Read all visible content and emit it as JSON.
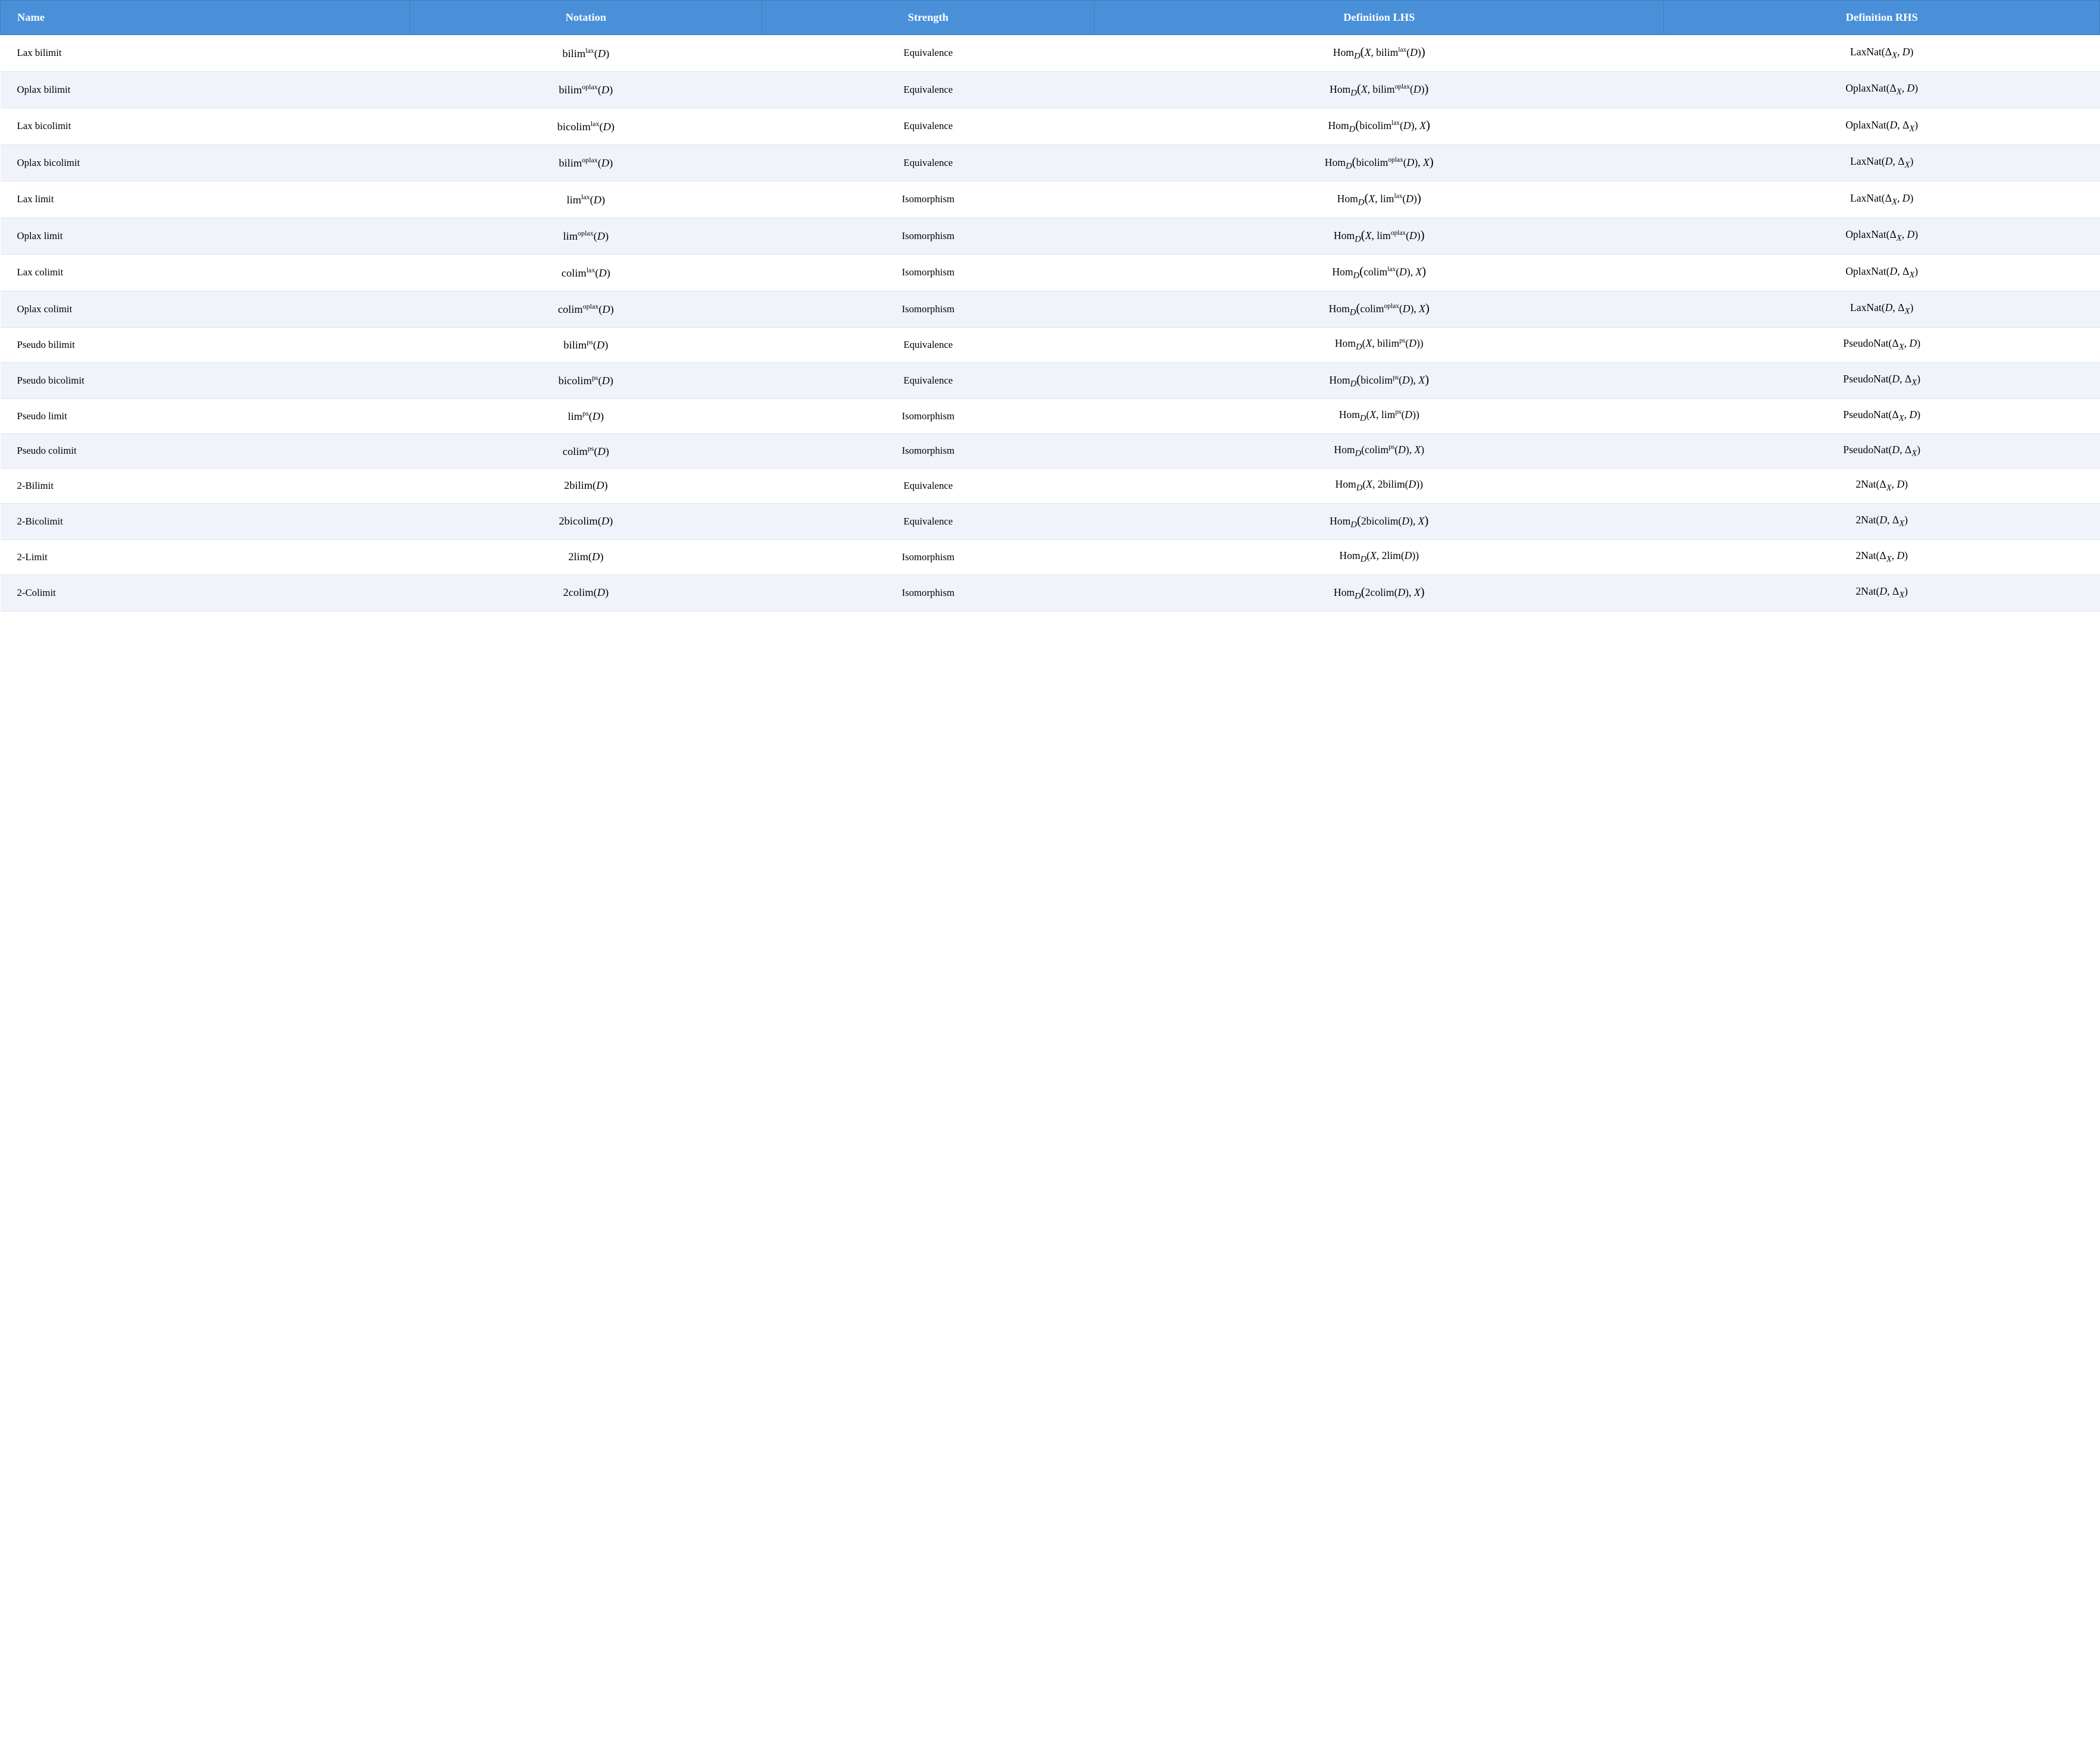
{
  "header": {
    "col1": "Name",
    "col2": "Notation",
    "col3": "Strength",
    "col4": "Definition LHS",
    "col5": "Definition RHS"
  },
  "rows": [
    {
      "name": "Lax bilimit",
      "notation_html": "bilim<sup>lax</sup>(<i>D</i>)",
      "strength": "Equivalence",
      "lhs_html": "Hom<sub><i>D</i></sub><big>(</big><i>X</i>, bilim<sup>lax</sup>(<i>D</i>)<big>)</big>",
      "rhs_html": "LaxNat(Δ<sub><i>X</i></sub>, <i>D</i>)"
    },
    {
      "name": "Oplax bilimit",
      "notation_html": "bilim<sup>oplax</sup>(<i>D</i>)",
      "strength": "Equivalence",
      "lhs_html": "Hom<sub><i>D</i></sub><big>(</big><i>X</i>, bilim<sup>oplax</sup>(<i>D</i>)<big>)</big>",
      "rhs_html": "OplaxNat(Δ<sub><i>X</i></sub>, <i>D</i>)"
    },
    {
      "name": "Lax bicolimit",
      "notation_html": "bicolim<sup>lax</sup>(<i>D</i>)",
      "strength": "Equivalence",
      "lhs_html": "Hom<sub><i>D</i></sub><big>(</big>bicolim<sup>lax</sup>(<i>D</i>), <i>X</i><big>)</big>",
      "rhs_html": "OplaxNat(<i>D</i>, Δ<sub><i>X</i></sub>)"
    },
    {
      "name": "Oplax bicolimit",
      "notation_html": "bilim<sup>oplax</sup>(<i>D</i>)",
      "strength": "Equivalence",
      "lhs_html": "Hom<sub><i>D</i></sub><big>(</big>bicolim<sup>oplax</sup>(<i>D</i>), <i>X</i><big>)</big>",
      "rhs_html": "LaxNat(<i>D</i>, Δ<sub><i>X</i></sub>)"
    },
    {
      "name": "Lax limit",
      "notation_html": "lim<sup>lax</sup>(<i>D</i>)",
      "strength": "Isomorphism",
      "lhs_html": "Hom<sub><i>D</i></sub><big>(</big><i>X</i>, lim<sup>lax</sup>(<i>D</i>)<big>)</big>",
      "rhs_html": "LaxNat(Δ<sub><i>X</i></sub>, <i>D</i>)"
    },
    {
      "name": "Oplax limit",
      "notation_html": "lim<sup>oplax</sup>(<i>D</i>)",
      "strength": "Isomorphism",
      "lhs_html": "Hom<sub><i>D</i></sub><big>(</big><i>X</i>, lim<sup>oplax</sup>(<i>D</i>)<big>)</big>",
      "rhs_html": "OplaxNat(Δ<sub><i>X</i></sub>, <i>D</i>)"
    },
    {
      "name": "Lax colimit",
      "notation_html": "colim<sup>lax</sup>(<i>D</i>)",
      "strength": "Isomorphism",
      "lhs_html": "Hom<sub><i>D</i></sub><big>(</big>colim<sup>lax</sup>(<i>D</i>), <i>X</i><big>)</big>",
      "rhs_html": "OplaxNat(<i>D</i>, Δ<sub><i>X</i></sub>)"
    },
    {
      "name": "Oplax colimit",
      "notation_html": "colim<sup>oplax</sup>(<i>D</i>)",
      "strength": "Isomorphism",
      "lhs_html": "Hom<sub><i>D</i></sub><big>(</big>colim<sup>oplax</sup>(<i>D</i>), <i>X</i><big>)</big>",
      "rhs_html": "LaxNat(<i>D</i>, Δ<sub><i>X</i></sub>)"
    },
    {
      "name": "Pseudo bilimit",
      "notation_html": "bilim<sup>ps</sup>(<i>D</i>)",
      "strength": "Equivalence",
      "lhs_html": "Hom<sub><i>D</i></sub>(<i>X</i>, bilim<sup>ps</sup>(<i>D</i>))",
      "rhs_html": "PseudoNat(Δ<sub><i>X</i></sub>, <i>D</i>)"
    },
    {
      "name": "Pseudo bicolimit",
      "notation_html": "bicolim<sup>ps</sup>(<i>D</i>)",
      "strength": "Equivalence",
      "lhs_html": "Hom<sub><i>D</i></sub><big>(</big>bicolim<sup>ps</sup>(<i>D</i>), <i>X</i><big>)</big>",
      "rhs_html": "PseudoNat(<i>D</i>, Δ<sub><i>X</i></sub>)"
    },
    {
      "name": "Pseudo limit",
      "notation_html": "lim<sup>ps</sup>(<i>D</i>)",
      "strength": "Isomorphism",
      "lhs_html": "Hom<sub><i>D</i></sub>(<i>X</i>, lim<sup>ps</sup>(<i>D</i>))",
      "rhs_html": "PseudoNat(Δ<sub><i>X</i></sub>, <i>D</i>)"
    },
    {
      "name": "Pseudo colimit",
      "notation_html": "colim<sup>ps</sup>(<i>D</i>)",
      "strength": "Isomorphism",
      "lhs_html": "Hom<sub><i>D</i></sub>(colim<sup>ps</sup>(<i>D</i>), <i>X</i>)",
      "rhs_html": "PseudoNat(<i>D</i>, Δ<sub><i>X</i></sub>)"
    },
    {
      "name": "2-Bilimit",
      "notation_html": "2bilim(<i>D</i>)",
      "strength": "Equivalence",
      "lhs_html": "Hom<sub><i>D</i></sub>(<i>X</i>, 2bilim(<i>D</i>))",
      "rhs_html": "2Nat(Δ<sub><i>X</i></sub>, <i>D</i>)"
    },
    {
      "name": "2-Bicolimit",
      "notation_html": "2bicolim(<i>D</i>)",
      "strength": "Equivalence",
      "lhs_html": "Hom<sub><i>D</i></sub><big>(</big>2bicolim(<i>D</i>), <i>X</i><big>)</big>",
      "rhs_html": "2Nat(<i>D</i>, Δ<sub><i>X</i></sub>)"
    },
    {
      "name": "2-Limit",
      "notation_html": "2lim(<i>D</i>)",
      "strength": "Isomorphism",
      "lhs_html": "Hom<sub><i>D</i></sub>(<i>X</i>, 2lim(<i>D</i>))",
      "rhs_html": "2Nat(Δ<sub><i>X</i></sub>, <i>D</i>)"
    },
    {
      "name": "2-Colimit",
      "notation_html": "2colim(<i>D</i>)",
      "strength": "Isomorphism",
      "lhs_html": "Hom<sub><i>D</i></sub><big>(</big>2colim(<i>D</i>), <i>X</i><big>)</big>",
      "rhs_html": "2Nat(<i>D</i>, Δ<sub><i>X</i></sub>)"
    }
  ]
}
